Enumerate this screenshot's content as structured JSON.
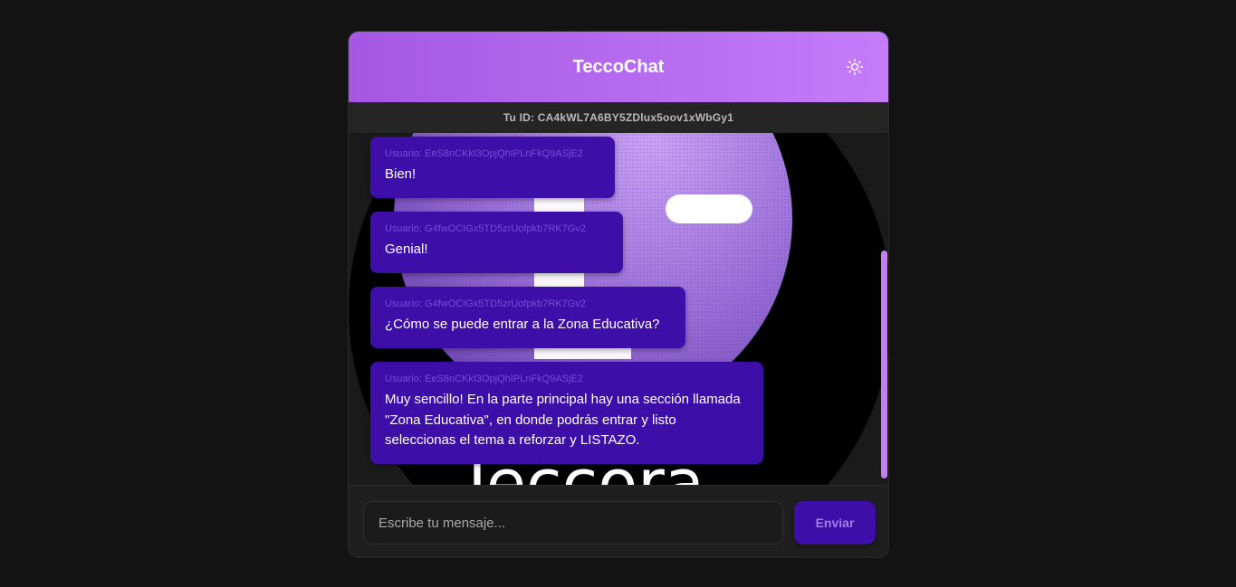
{
  "app": {
    "title": "TeccoChat"
  },
  "header": {
    "theme_icon": "sun-icon"
  },
  "id_bar": {
    "text": "Tu ID: CA4kWL7A6BY5ZDlux5oov1xWbGy1"
  },
  "messages": [
    {
      "user": "Usuario: EeS8nCKkI3OpjQhIPLnFkQ9ASjE2",
      "text": "Bien!"
    },
    {
      "user": "Usuario: G4fwOCIGx5TD5zrUofpkb7RK7Gv2",
      "text": "Genial!"
    },
    {
      "user": "Usuario: G4fwOCIGx5TD5zrUofpkb7RK7Gv2",
      "text": "¿Cómo se puede entrar a la Zona Educativa?"
    },
    {
      "user": "Usuario: EeS8nCKkI3OpjQhIPLnFkQ9ASjE2",
      "text": "Muy sencillo! En la parte principal hay una sección llamada \"Zona Educativa\", en donde podrás entrar y listo seleccionas el tema a reforzar y LISTAZO."
    }
  ],
  "background_logo_text": "Teccora",
  "composer": {
    "placeholder": "Escribe tu mensaje...",
    "send_label": "Enviar"
  },
  "colors": {
    "header_start": "#a557e4",
    "header_end": "#c57cf9",
    "bubble": "#3e0ea9",
    "accent": "#c57cf9"
  }
}
